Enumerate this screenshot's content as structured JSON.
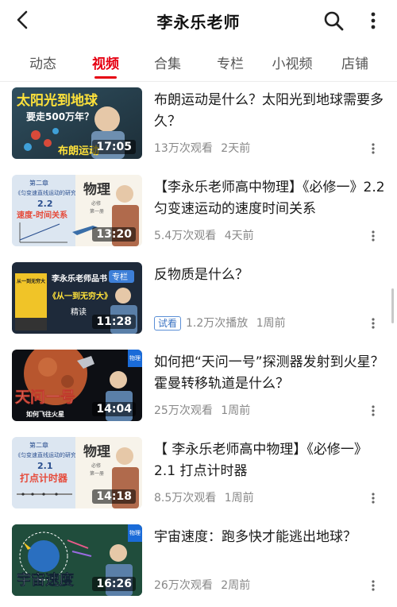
{
  "header": {
    "title": "李永乐老师"
  },
  "tabs": [
    "动态",
    "视频",
    "合集",
    "专栏",
    "小视频",
    "店铺"
  ],
  "active_tab": "视频",
  "accent_color": "#e60012",
  "videos": [
    {
      "title": "布朗运动是什么？太阳光到地球需要多久？",
      "duration": "17:05",
      "views": "13万次观看",
      "time": "2天前",
      "thumb_text": [
        "太阳光到地球",
        "要走500万年？",
        "布朗运动"
      ]
    },
    {
      "title": "【李永乐老师高中物理】《必修一》2.2 匀变速运动的速度时间关系",
      "duration": "13:20",
      "views": "5.4万次观看",
      "time": "4天前",
      "thumb_text": [
        "第二章",
        "《匀变速直线运动的研究》",
        "2.2",
        "速度-时间关系",
        "物理",
        "必修",
        "第一册"
      ]
    },
    {
      "title": "反物质是什么？",
      "duration": "11:28",
      "badge": "试看",
      "views": "1.2万次播放",
      "time": "1周前",
      "thumb_text": [
        "李永乐老师品书",
        "《从一到无穷大》",
        "精读",
        "专栏",
        "从一到无穷大"
      ]
    },
    {
      "title": "如何把“天问一号”探测器发射到火星？霍曼转移轨道是什么？",
      "duration": "14:04",
      "views": "25万次观看",
      "time": "1周前",
      "thumb_text": [
        "天问一号",
        "如何飞往火星",
        "物理"
      ]
    },
    {
      "title": "【 李永乐老师高中物理】《必修一》2.1 打点计时器",
      "duration": "14:18",
      "views": "8.5万次观看",
      "time": "1周前",
      "thumb_text": [
        "第二章",
        "《匀变速直线运动的研究》",
        "2.1",
        "打点计时器",
        "物理",
        "必修",
        "第一册"
      ]
    },
    {
      "title": "宇宙速度：跑多快才能逃出地球？",
      "duration": "16:26",
      "views": "26万次观看",
      "time": "2周前",
      "thumb_text": [
        "宇宙速度",
        "物理"
      ]
    }
  ]
}
